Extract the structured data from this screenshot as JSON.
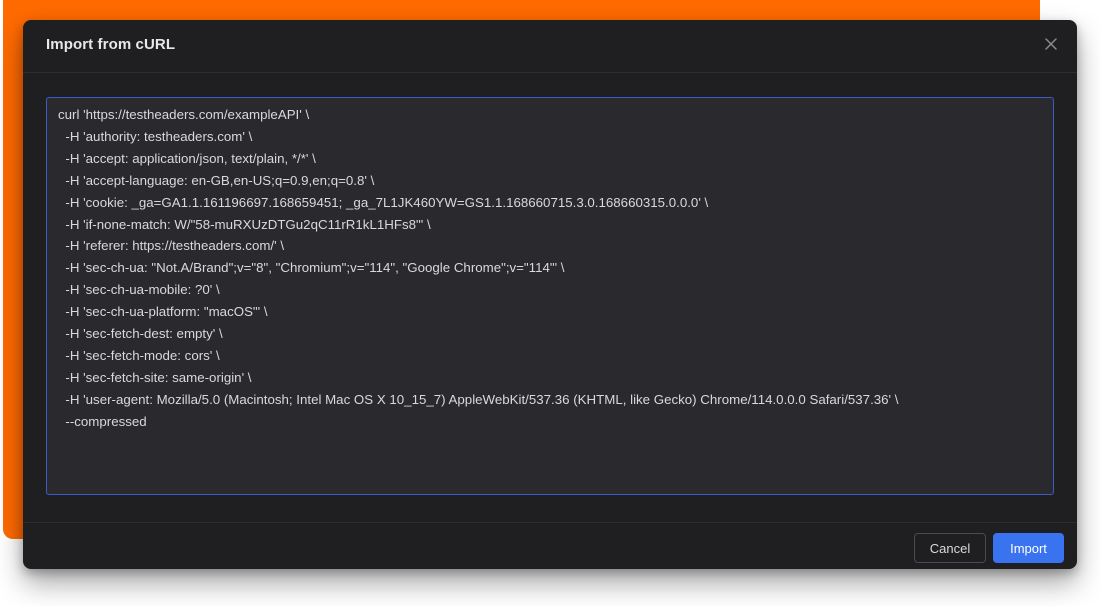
{
  "colors": {
    "backdrop": "#ff6a00",
    "dialog_bg": "#1f1f21",
    "editor_bg": "#2a2a2e",
    "editor_border": "#3b5cc4",
    "primary": "#3a73f0"
  },
  "dialog": {
    "title": "Import from cURL",
    "close_icon": "close-icon"
  },
  "editor": {
    "lines": [
      "curl 'https://testheaders.com/exampleAPI' \\",
      "  -H 'authority: testheaders.com' \\",
      "  -H 'accept: application/json, text/plain, */*' \\",
      "  -H 'accept-language: en-GB,en-US;q=0.9,en;q=0.8' \\",
      "  -H 'cookie: _ga=GA1.1.161196697.168659451; _ga_7L1JK460YW=GS1.1.168660715.3.0.168660315.0.0.0' \\",
      "  -H 'if-none-match: W/\"58-muRXUzDTGu2qC11rR1kL1HFs8\"' \\",
      "  -H 'referer: https://testheaders.com/' \\",
      "  -H 'sec-ch-ua: \"Not.A/Brand\";v=\"8\", \"Chromium\";v=\"114\", \"Google Chrome\";v=\"114\"' \\",
      "  -H 'sec-ch-ua-mobile: ?0' \\",
      "  -H 'sec-ch-ua-platform: \"macOS\"' \\",
      "  -H 'sec-fetch-dest: empty' \\",
      "  -H 'sec-fetch-mode: cors' \\",
      "  -H 'sec-fetch-site: same-origin' \\",
      "  -H 'user-agent: Mozilla/5.0 (Macintosh; Intel Mac OS X 10_15_7) AppleWebKit/537.36 (KHTML, like Gecko) Chrome/114.0.0.0 Safari/537.36' \\",
      "  --compressed"
    ]
  },
  "footer": {
    "cancel_label": "Cancel",
    "import_label": "Import"
  }
}
